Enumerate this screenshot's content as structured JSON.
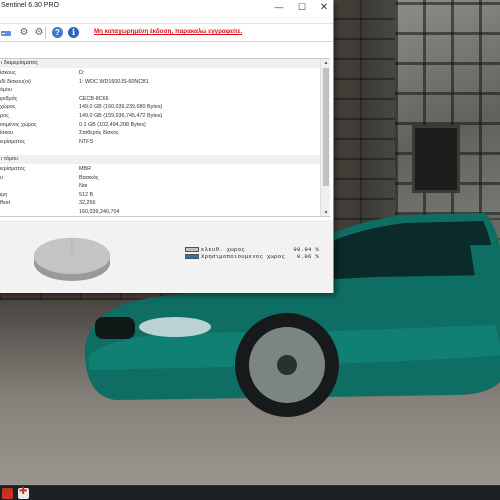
{
  "window": {
    "title": "Sentinel 6.30 PRO",
    "minimize_glyph": "—",
    "maximize_glyph": "☐",
    "close_glyph": "✕"
  },
  "toolbar": {
    "icons": [
      "drive-icon",
      "gear-icon",
      "gear-icon",
      "help-icon",
      "info-icon"
    ],
    "help_glyph": "?",
    "info_glyph": "i",
    "update_notice": "Μη καταχωρημένη έκδοση, παρακαλώ εγγραφείτε."
  },
  "sections": [
    {
      "title": "ι διαμερίσματος"
    },
    {
      "title": "ι τόμου"
    }
  ],
  "partition_rows": [
    {
      "key": "ίσκους",
      "value": "D:"
    },
    {
      "key": "ιδί δίσκου(οι)",
      "value": "1: WDC WD1600JS-60NCB1"
    },
    {
      "key": "όμου",
      "value": ""
    },
    {
      "key": "ιριθμός",
      "value": "CECB-8C66"
    },
    {
      "key": "χώρος",
      "value": "149.0 GB (160,039,239,680 Bytes)"
    },
    {
      "key": "ρος",
      "value": "149.0 GB (159,936,745,472 Bytes)"
    },
    {
      "key": "ισιμένος χώρος",
      "value": "0.1 GB (102,494,208 Bytes)"
    },
    {
      "key": "ίσκου",
      "value": "Σταθερός δίσκος"
    },
    {
      "key": "ιερίσματος",
      "value": "NTFS"
    }
  ],
  "volume_rows": [
    {
      "key": "ιερίσματος",
      "value": "MBR"
    },
    {
      "key": "υ",
      "value": "Βασικός"
    },
    {
      "key": "",
      "value": "Ναι"
    },
    {
      "key": "ιμη",
      "value": "512 B"
    },
    {
      "key": "ffset",
      "value": "32,256"
    },
    {
      "key": "",
      "value": "160,039,240,704"
    }
  ],
  "scrollbar": {
    "up_glyph": "▲",
    "down_glyph": "▼"
  },
  "chart_data": {
    "type": "pie",
    "labels": [
      "ελευθ. χωρος",
      "Χρησιμοποιουμενος χωρος"
    ],
    "values": [
      99.94,
      0.06
    ],
    "value_labels": [
      "99.94 %",
      "0.06 %"
    ],
    "colors": [
      "#c4c4c4",
      "#2f6fb3"
    ],
    "legend_position": "right"
  },
  "colors": {
    "update_notice": "#d8141c",
    "pie_free": "#c4c4c4",
    "pie_used": "#2f6fb3"
  }
}
